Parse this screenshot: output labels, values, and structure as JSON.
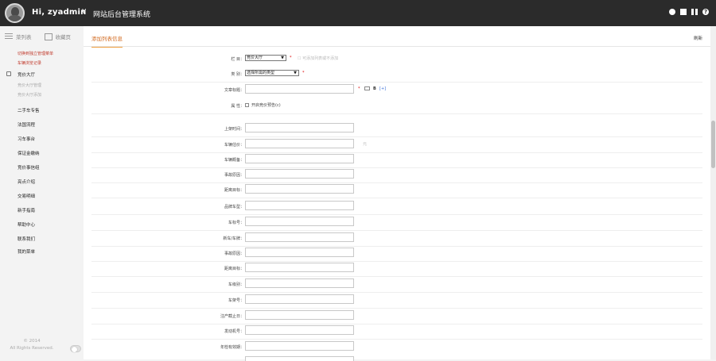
{
  "header": {
    "greeting": "Hi, zyadmin",
    "chevron": "∨",
    "system_title": "网站后台管理系统",
    "icons": [
      "settings-circle-icon",
      "monitor-icon",
      "grid-icon",
      "help-icon"
    ],
    "help_glyph": "?"
  },
  "sidebar": {
    "tabs": [
      {
        "label": "菜列表",
        "icon": "list-icon"
      },
      {
        "label": "收藏页",
        "icon": "calendar-icon"
      }
    ],
    "section_links": [
      {
        "label": "切换到独立管理菜单",
        "color": "#c0392b"
      },
      {
        "label": "车辆浏览记录",
        "color": "#c0392b"
      }
    ],
    "active_item": "竞价大厅",
    "sub_items": [
      "竞价大厅管理",
      "竞价大厅添加"
    ],
    "items": [
      "二手车专售",
      "法国流程",
      "习车事台",
      "保证金缴纳",
      "竞价事信组",
      "亮点介绍",
      "交易明细",
      "新手指南",
      "帮助中心",
      "联系我们",
      "我的菜单"
    ],
    "footer_line1": "© 2014",
    "footer_line2": "All Rights Reserved."
  },
  "main": {
    "tab_label": "添加列表信息",
    "refresh_label": "刷新",
    "column": {
      "label": "栏  目：",
      "value": "竞价大厅",
      "hint": "可添加列表或不添加"
    },
    "category": {
      "label": "类  别：",
      "value": "选择所需的类型"
    },
    "title_field": {
      "label": "文章标题：",
      "bold": "B",
      "extra": "[+]"
    },
    "attributes": {
      "label": "属  性：",
      "option": "开启竞价预告(c)"
    },
    "fields": [
      "上架时间：",
      "车辆估价：",
      "车辆概备：",
      "事故原因：",
      "距离目标：",
      "品牌车型：",
      "车标号：",
      "新车/车牌：",
      "事故原因：",
      "距离目标：",
      "车级别：",
      "车架号：",
      "注产截止日：",
      "发动机号：",
      "年检有效期："
    ],
    "price_unit": "元"
  },
  "colors": {
    "topbar": "#2b2b2b",
    "accent": "#f0a040",
    "danger": "#d00000"
  }
}
